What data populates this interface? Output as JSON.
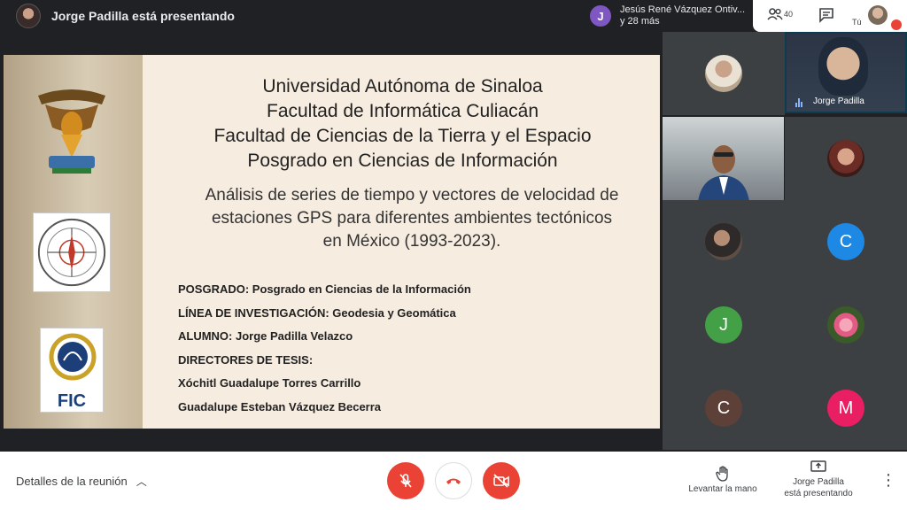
{
  "top_bar": {
    "presenter_text": "Jorge Padilla está presentando",
    "notification": {
      "initial": "J",
      "line1": "Jesús René Vázquez Ontiv...",
      "line2": "y 28 más"
    },
    "people_count": "40",
    "you_label": "Tú"
  },
  "slide": {
    "title_lines": [
      "Universidad Autónoma de Sinaloa",
      "Facultad de Informática Culiacán",
      "Facultad de Ciencias de la Tierra y el Espacio",
      "Posgrado en Ciencias de Información"
    ],
    "subtitle_lines": [
      "Análisis de series de tiempo y vectores de velocidad de",
      "estaciones GPS para diferentes ambientes tectónicos",
      "en México (1993-2023)."
    ],
    "details": [
      "POSGRADO: Posgrado en Ciencias de la Información",
      "LÍNEA DE INVESTIGACIÓN: Geodesia y Geomática",
      "ALUMNO: Jorge Padilla Velazco",
      "DIRECTORES DE TESIS:",
      "Xóchitl Guadalupe Torres Carrillo",
      "Guadalupe Esteban Vázquez Becerra"
    ],
    "fic_logo_text": "FIC"
  },
  "participants": {
    "active_speaker": "Jorge Padilla",
    "initials": [
      "C",
      "J",
      "C",
      "M"
    ]
  },
  "bottom_bar": {
    "meeting_details": "Detalles de la reunión",
    "raise_hand": "Levantar la mano",
    "presenting_line1": "Jorge Padilla",
    "presenting_line2": "está presentando"
  },
  "colors": {
    "red": "#ea4335",
    "tile_bg": "#3c4043",
    "blue_avatar": "#1e88e5",
    "green_avatar": "#43a047",
    "brown_avatar": "#5d4037",
    "pink_avatar": "#e91e63",
    "purple_avatar": "#7e57c2"
  }
}
